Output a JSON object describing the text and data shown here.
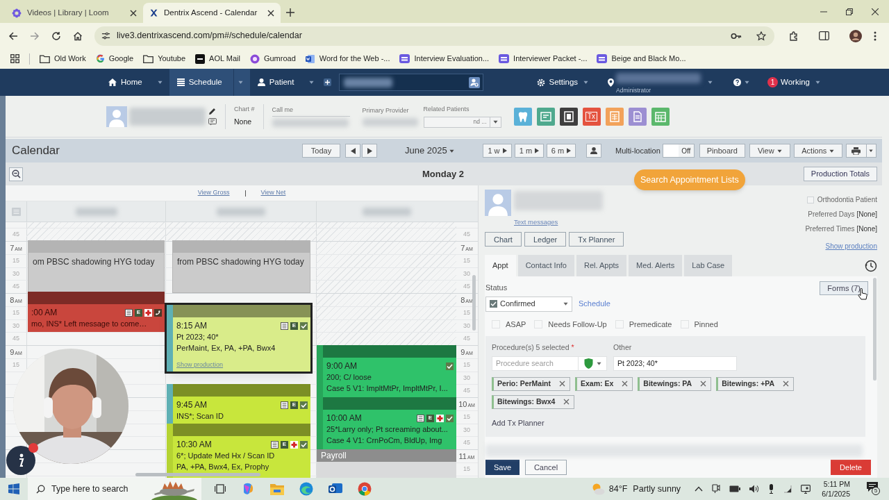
{
  "browser": {
    "tabs": [
      {
        "title": "Videos | Library | Loom",
        "selected": false,
        "kind": "loom"
      },
      {
        "title": "Dentrix Ascend - Calendar",
        "selected": true,
        "kind": "dentrix"
      }
    ],
    "url": "live3.dentrixascend.com/pm#/schedule/calendar",
    "bookmarks": [
      {
        "label": "Old Work",
        "kind": "folder"
      },
      {
        "label": "Google",
        "kind": "google"
      },
      {
        "label": "Youtube",
        "kind": "folder"
      },
      {
        "label": "AOL Mail",
        "kind": "aol"
      },
      {
        "label": "Gumroad",
        "kind": "gumroad"
      },
      {
        "label": "Word for the Web -...",
        "kind": "word"
      },
      {
        "label": "Interview Evaluation...",
        "kind": "form"
      },
      {
        "label": "Interviewer Packet -...",
        "kind": "form"
      },
      {
        "label": "Beige and Black Mo...",
        "kind": "form"
      }
    ]
  },
  "nav": {
    "items": [
      {
        "label": "Home",
        "kind": "home",
        "selected": false
      },
      {
        "label": "Schedule",
        "kind": "schedule",
        "selected": true
      },
      {
        "label": "Patient",
        "kind": "patient",
        "selected": false
      }
    ],
    "settings": "Settings",
    "location_role": "Administrator",
    "alert_count": "1",
    "status": "Working"
  },
  "patient_bar": {
    "chart_label": "Chart #",
    "chart_value": "None",
    "call_me": "Call me",
    "primary_provider": "Primary Provider",
    "related_patients": "Related Patients",
    "related_value": "nd ...",
    "tx_tile": "Tx"
  },
  "calendar_header": {
    "title": "Calendar",
    "today": "Today",
    "month": "June 2025",
    "ranges": [
      "1 w",
      "1 m",
      "6 m"
    ],
    "multi_location": "Multi-location",
    "multi_location_on": false,
    "toggle_label": "Off",
    "pinboard": "Pinboard",
    "view": "View",
    "actions": "Actions"
  },
  "day": {
    "title": "Monday 2",
    "view_gross": "View Gross",
    "view_net": "View Net",
    "production_totals": "Production Totals",
    "search_lists": "Search Appointment Lists"
  },
  "time_labels_left": [
    {
      "text": "45"
    },
    {
      "text": "7",
      "ampm": "AM"
    },
    {
      "text": "15"
    },
    {
      "text": "30"
    },
    {
      "text": "45"
    },
    {
      "text": "8",
      "ampm": "AM"
    },
    {
      "text": "15"
    },
    {
      "text": "30"
    },
    {
      "text": "45"
    },
    {
      "text": "9",
      "ampm": "AM"
    },
    {
      "text": "15"
    }
  ],
  "time_labels_right": [
    {
      "text": "45"
    },
    {
      "text": "7",
      "ampm": "AM"
    },
    {
      "text": "15"
    },
    {
      "text": "30"
    },
    {
      "text": "45"
    },
    {
      "text": "8",
      "ampm": "AM"
    },
    {
      "text": "15"
    },
    {
      "text": "30"
    },
    {
      "text": "45"
    },
    {
      "text": "9",
      "ampm": "AM"
    },
    {
      "text": "15"
    },
    {
      "text": "30"
    },
    {
      "text": "45"
    },
    {
      "text": "10",
      "ampm": "AM"
    },
    {
      "text": "15"
    },
    {
      "text": "30"
    },
    {
      "text": "45"
    },
    {
      "text": "11",
      "ampm": "AM"
    },
    {
      "text": "15"
    }
  ],
  "appointments": [
    {
      "kind": "block",
      "text": "om PBSC shadowing HYG today"
    },
    {
      "kind": "block",
      "text": "from PBSC shadowing HYG today"
    },
    {
      "kind": "appt",
      "color": "#c9463d",
      "selected": false,
      "time": ":00 AM",
      "lines": [
        "mo, INS* Left message to come…"
      ],
      "icons": [
        {
          "kind": "note"
        },
        {
          "kind": "letter",
          "text": "E"
        },
        {
          "kind": "plus"
        },
        {
          "kind": "phone"
        }
      ]
    },
    {
      "kind": "appt",
      "color": "#d9ec8a",
      "selected": true,
      "time": "8:15 AM",
      "lines": [
        "Pt 2023; 40*",
        "PerMaint, Ex, PA, +PA, Bwx4"
      ],
      "link": "Show production",
      "icons": [
        {
          "kind": "note"
        },
        {
          "kind": "letter",
          "text": "E"
        },
        {
          "kind": "check"
        }
      ]
    },
    {
      "kind": "appt",
      "color": "#2fc26a",
      "selected": false,
      "time": "9:00 AM",
      "lines": [
        "200; C/ loose",
        "Case 5 V1: ImpltMtPr, ImpltMtPr, I..."
      ],
      "icons": [
        {
          "kind": "check"
        }
      ]
    },
    {
      "kind": "appt",
      "color": "#c8e63c",
      "selected": false,
      "time": "9:45 AM",
      "lines": [
        "INS*; Scan ID"
      ],
      "icons": [
        {
          "kind": "note"
        },
        {
          "kind": "letter",
          "text": "E"
        },
        {
          "kind": "check"
        }
      ]
    },
    {
      "kind": "appt",
      "color": "#2fc26a",
      "selected": false,
      "time": "10:00 AM",
      "lines": [
        "25*Larry only; Pt screaming about...",
        "Case 4 V1: CrnPoCm, BldUp, Img"
      ],
      "icons": [
        {
          "kind": "note"
        },
        {
          "kind": "letter",
          "text": "E"
        },
        {
          "kind": "plus"
        },
        {
          "kind": "check"
        }
      ]
    },
    {
      "kind": "appt",
      "color": "#c8e63c",
      "selected": false,
      "time": "10:30 AM",
      "lines": [
        "6*; Update Med Hx / Scan ID",
        "PA, +PA, Bwx4, Ex, Prophy"
      ],
      "icons": [
        {
          "kind": "note"
        },
        {
          "kind": "letter",
          "text": "E"
        },
        {
          "kind": "plus"
        },
        {
          "kind": "check"
        }
      ]
    },
    {
      "kind": "banner",
      "text": "Payroll"
    }
  ],
  "patient_panel": {
    "text_messages": "Text messages",
    "orthodontia": {
      "label": "Orthodontia Patient",
      "checked": false
    },
    "preferred_days": {
      "label": "Preferred Days",
      "value": "[None]"
    },
    "preferred_times": {
      "label": "Preferred Times",
      "value": "[None]"
    },
    "show_production": "Show production",
    "buttons": [
      "Chart",
      "Ledger",
      "Tx Planner"
    ]
  },
  "tabs": [
    {
      "label": "Appt",
      "selected": true
    },
    {
      "label": "Contact Info",
      "selected": false
    },
    {
      "label": "Rel. Appts",
      "selected": false
    },
    {
      "label": "Med. Alerts",
      "selected": false
    },
    {
      "label": "Lab Case",
      "selected": false
    }
  ],
  "appt_form": {
    "status_label": "Status",
    "status": {
      "value": "Confirmed",
      "checked": true
    },
    "schedule_link": "Schedule",
    "forms": "Forms (7)",
    "flags": [
      {
        "label": "ASAP",
        "checked": false
      },
      {
        "label": "Needs Follow-Up",
        "checked": false
      },
      {
        "label": "Premedicate",
        "checked": false
      },
      {
        "label": "Pinned",
        "checked": false
      }
    ],
    "procedures_label": "Procedure(s) 5 selected",
    "required_mark": "*",
    "other_label": "Other",
    "procedure_placeholder": "Procedure search",
    "other_value": "Pt 2023; 40*",
    "procedures": [
      {
        "text": "Perio: PerMaint"
      },
      {
        "text": "Exam: Ex"
      },
      {
        "text": "Bitewings: PA"
      },
      {
        "text": "Bitewings: +PA"
      },
      {
        "text": "Bitewings: Bwx4"
      }
    ],
    "add_tx_planner": "Add Tx Planner",
    "save": "Save",
    "cancel": "Cancel",
    "delete": "Delete"
  },
  "taskbar": {
    "search_placeholder": "Type here to search",
    "temperature": "84°F",
    "weather": "Partly sunny",
    "time": "5:11 PM",
    "date": "6/1/2025",
    "notifications": "5"
  }
}
